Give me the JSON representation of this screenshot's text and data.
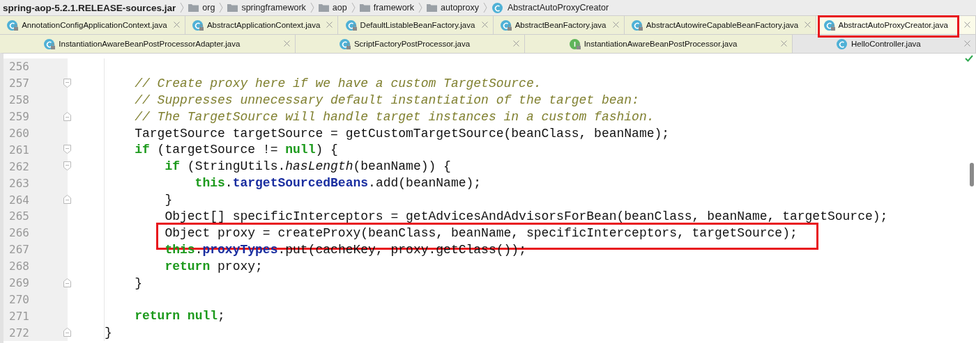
{
  "breadcrumbs": [
    {
      "kind": "jar",
      "label": "spring-aop-5.2.1.RELEASE-sources.jar"
    },
    {
      "kind": "folder",
      "label": "org"
    },
    {
      "kind": "folder",
      "label": "springframework"
    },
    {
      "kind": "folder",
      "label": "aop"
    },
    {
      "kind": "folder",
      "label": "framework"
    },
    {
      "kind": "folder",
      "label": "autoproxy"
    },
    {
      "kind": "class",
      "label": "AbstractAutoProxyCreator"
    }
  ],
  "tab_rows": [
    [
      {
        "label": "AnnotationConfigApplicationContext.java",
        "kind": "class",
        "read_only": true,
        "selected": false,
        "highlighted": false
      },
      {
        "label": "AbstractApplicationContext.java",
        "kind": "class",
        "read_only": true,
        "selected": false,
        "highlighted": false
      },
      {
        "label": "DefaultListableBeanFactory.java",
        "kind": "class",
        "read_only": true,
        "selected": false,
        "highlighted": false
      },
      {
        "label": "AbstractBeanFactory.java",
        "kind": "class",
        "read_only": true,
        "selected": false,
        "highlighted": false
      },
      {
        "label": "AbstractAutowireCapableBeanFactory.java",
        "kind": "class",
        "read_only": true,
        "selected": false,
        "highlighted": false
      },
      {
        "label": "AbstractAutoProxyCreator.java",
        "kind": "class",
        "read_only": true,
        "selected": true,
        "highlighted": true
      }
    ],
    [
      {
        "label": "InstantiationAwareBeanPostProcessorAdapter.java",
        "kind": "class",
        "read_only": true,
        "selected": false,
        "highlighted": false
      },
      {
        "label": "ScriptFactoryPostProcessor.java",
        "kind": "class",
        "read_only": true,
        "selected": false,
        "highlighted": false
      },
      {
        "label": "InstantiationAwareBeanPostProcessor.java",
        "kind": "interface",
        "read_only": true,
        "selected": false,
        "highlighted": false
      },
      {
        "label": "HelloController.java",
        "kind": "class",
        "read_only": false,
        "selected": false,
        "highlighted": false
      }
    ]
  ],
  "editor": {
    "lines": [
      {
        "number": "256",
        "kind": "plain",
        "highlighted": false
      },
      {
        "number": "257",
        "kind": "opener",
        "highlighted": false,
        "tokens": [
          {
            "kind": "comment",
            "t": "    // Create proxy here if we have a custom TargetSource."
          }
        ]
      },
      {
        "number": "258",
        "kind": "plain",
        "highlighted": false,
        "tokens": [
          {
            "kind": "comment",
            "t": "    // Suppresses unnecessary default instantiation of the target bean:"
          }
        ]
      },
      {
        "number": "259",
        "kind": "closer",
        "highlighted": false,
        "tokens": [
          {
            "kind": "comment",
            "t": "    // The TargetSource will handle target instances in a custom fashion."
          }
        ]
      },
      {
        "number": "260",
        "kind": "plain",
        "highlighted": false,
        "tokens": [
          {
            "kind": "plain",
            "t": "    TargetSource targetSource = getCustomTargetSource(beanClass, beanName);"
          }
        ]
      },
      {
        "number": "261",
        "kind": "opener",
        "highlighted": false,
        "tokens": [
          {
            "kind": "keyword",
            "t": "    if"
          },
          {
            "kind": "plain",
            "t": " (targetSource != "
          },
          {
            "kind": "keyword",
            "t": "null"
          },
          {
            "kind": "plain",
            "t": ") {"
          }
        ]
      },
      {
        "number": "262",
        "kind": "opener",
        "highlighted": false,
        "tokens": [
          {
            "kind": "keyword",
            "t": "        if"
          },
          {
            "kind": "plain",
            "t": " (StringUtils."
          },
          {
            "kind": "static",
            "t": "hasLength"
          },
          {
            "kind": "plain",
            "t": "(beanName)) {"
          }
        ]
      },
      {
        "number": "263",
        "kind": "plain",
        "highlighted": false,
        "tokens": [
          {
            "kind": "keyword",
            "t": "            this"
          },
          {
            "kind": "plain",
            "t": "."
          },
          {
            "kind": "field",
            "t": "targetSourcedBeans"
          },
          {
            "kind": "plain",
            "t": ".add(beanName);"
          }
        ]
      },
      {
        "number": "264",
        "kind": "closer",
        "highlighted": false,
        "tokens": [
          {
            "kind": "plain",
            "t": "        }"
          }
        ]
      },
      {
        "number": "265",
        "kind": "plain",
        "highlighted": false,
        "tokens": [
          {
            "kind": "plain",
            "t": "        Object[] specificInterceptors = getAdvicesAndAdvisorsForBean(beanClass, beanName, targetSource);"
          }
        ]
      },
      {
        "number": "266",
        "kind": "plain",
        "highlighted": true,
        "tokens": [
          {
            "kind": "plain",
            "t": "        Object proxy = createProxy(beanClass, beanName, specificInterceptors, targetSource);"
          }
        ]
      },
      {
        "number": "267",
        "kind": "plain",
        "highlighted": false,
        "tokens": [
          {
            "kind": "keyword",
            "t": "        this"
          },
          {
            "kind": "plain",
            "t": "."
          },
          {
            "kind": "field",
            "t": "proxyTypes"
          },
          {
            "kind": "plain",
            "t": ".put(cacheKey, proxy.getClass());"
          }
        ]
      },
      {
        "number": "268",
        "kind": "plain",
        "highlighted": false,
        "tokens": [
          {
            "kind": "keyword",
            "t": "        return"
          },
          {
            "kind": "plain",
            "t": " proxy;"
          }
        ]
      },
      {
        "number": "269",
        "kind": "closer",
        "highlighted": false,
        "tokens": [
          {
            "kind": "plain",
            "t": "    }"
          }
        ]
      },
      {
        "number": "270",
        "kind": "plain",
        "highlighted": false
      },
      {
        "number": "271",
        "kind": "plain",
        "highlighted": false,
        "tokens": [
          {
            "kind": "keyword",
            "t": "    return"
          },
          {
            "kind": "keyword",
            "t": " null"
          },
          {
            "kind": "plain",
            "t": ";"
          }
        ]
      },
      {
        "number": "272",
        "kind": "closer",
        "highlighted": false,
        "tokens": [
          {
            "kind": "plain",
            "t": "}"
          }
        ]
      }
    ]
  }
}
